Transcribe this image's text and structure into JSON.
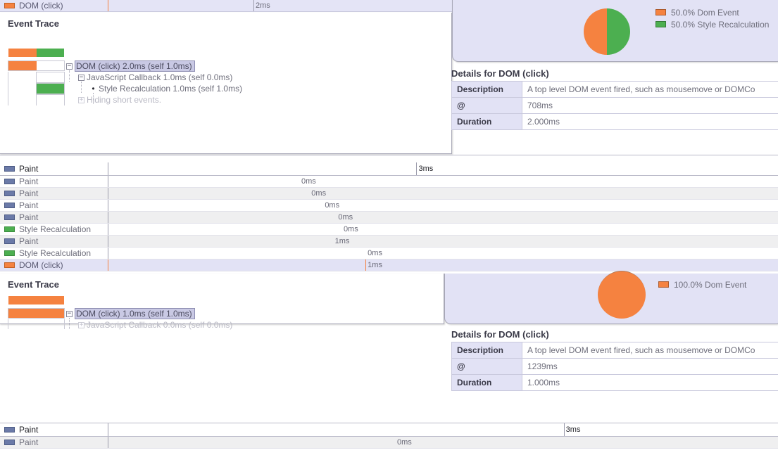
{
  "colors": {
    "dom_event": "#f58240",
    "style_recalculation": "#4caf50",
    "paint": "#6b7aa8",
    "selection": "#e2e2f5",
    "panel_bg": "#e2e2f5"
  },
  "top_row": {
    "label": "DOM (click)",
    "icon": "dom-event-swatch",
    "time": "2ms"
  },
  "trace_one": {
    "title": "Event Trace",
    "tree": [
      {
        "expander": "−",
        "text": "DOM (click) 2.0ms (self 1.0ms)",
        "depth": 0,
        "selected": true,
        "dim": false
      },
      {
        "expander": "−",
        "text": "JavaScript Callback 1.0ms (self 0.0ms)",
        "depth": 1,
        "selected": false,
        "dim": false
      },
      {
        "expander": "•",
        "text": "Style Recalculation 1.0ms (self 1.0ms)",
        "depth": 2,
        "selected": false,
        "dim": false
      },
      {
        "expander": "+",
        "text": "Hiding short events.",
        "depth": 1,
        "selected": false,
        "dim": true
      }
    ]
  },
  "pie_one": {
    "legend": [
      {
        "label": "50.0% Dom Event",
        "color": "#f58240"
      },
      {
        "label": "50.0% Style Recalculation",
        "color": "#4caf50"
      }
    ],
    "slices": [
      {
        "name": "Dom Event",
        "value": 50.0,
        "color": "#f58240"
      },
      {
        "name": "Style Recalculation",
        "value": 50.0,
        "color": "#4caf50"
      }
    ]
  },
  "details_one": {
    "title": "Details for DOM (click)",
    "rows": [
      {
        "key": "Description",
        "value": "A top level DOM event fired, such as mousemove or DOMCo"
      },
      {
        "key": "@",
        "value": "708ms"
      },
      {
        "key": "Duration",
        "value": "2.000ms"
      }
    ]
  },
  "timeline_mid": {
    "header": {
      "label": "Paint",
      "icon": "paint-swatch",
      "time": "3ms",
      "tick_pct": 46.0
    },
    "rows": [
      {
        "label": "Paint",
        "icon": "paint-swatch",
        "time": "0ms",
        "time_pct": 28.5,
        "alt": false,
        "selected": false
      },
      {
        "label": "Paint",
        "icon": "paint-swatch",
        "time": "0ms",
        "time_pct": 30.0,
        "alt": true,
        "selected": false
      },
      {
        "label": "Paint",
        "icon": "paint-swatch",
        "time": "0ms",
        "time_pct": 32.0,
        "alt": false,
        "selected": false
      },
      {
        "label": "Paint",
        "icon": "paint-swatch",
        "time": "0ms",
        "time_pct": 34.0,
        "alt": true,
        "selected": false
      },
      {
        "label": "Style Recalculation",
        "icon": "style-swatch",
        "time": "0ms",
        "time_pct": 34.8,
        "alt": false,
        "selected": false
      },
      {
        "label": "Paint",
        "icon": "paint-swatch",
        "time": "1ms",
        "time_pct": 33.5,
        "alt": true,
        "selected": false
      },
      {
        "label": "Style Recalculation",
        "icon": "style-swatch",
        "time": "0ms",
        "time_pct": 38.4,
        "alt": false,
        "selected": false
      },
      {
        "label": "DOM (click)",
        "icon": "dom-event-swatch",
        "time": "1ms",
        "time_pct": 38.4,
        "alt": false,
        "selected": true
      }
    ]
  },
  "trace_two": {
    "title": "Event Trace",
    "tree": [
      {
        "expander": "−",
        "text": "DOM (click) 1.0ms (self 1.0ms)",
        "depth": 0,
        "selected": true,
        "dim": false
      },
      {
        "expander": "+",
        "text": "JavaScript Callback 0.0ms (self 0.0ms)",
        "depth": 1,
        "selected": false,
        "dim": true
      }
    ]
  },
  "pie_two": {
    "legend": [
      {
        "label": "100.0% Dom Event",
        "color": "#f58240"
      }
    ],
    "slices": [
      {
        "name": "Dom Event",
        "value": 100.0,
        "color": "#f58240"
      }
    ]
  },
  "details_two": {
    "title": "Details for DOM (click)",
    "rows": [
      {
        "key": "Description",
        "value": "A top level DOM event fired, such as mousemove or DOMCo"
      },
      {
        "key": "@",
        "value": "1239ms"
      },
      {
        "key": "Duration",
        "value": "1.000ms"
      }
    ]
  },
  "timeline_bottom": {
    "rows": [
      {
        "label": "Paint",
        "icon": "paint-swatch",
        "time": "3ms",
        "time_pct": 68.0,
        "header": true,
        "alt": false
      },
      {
        "label": "Paint",
        "icon": "paint-swatch",
        "time": "0ms",
        "time_pct": 42.8,
        "header": false,
        "alt": true
      }
    ]
  }
}
